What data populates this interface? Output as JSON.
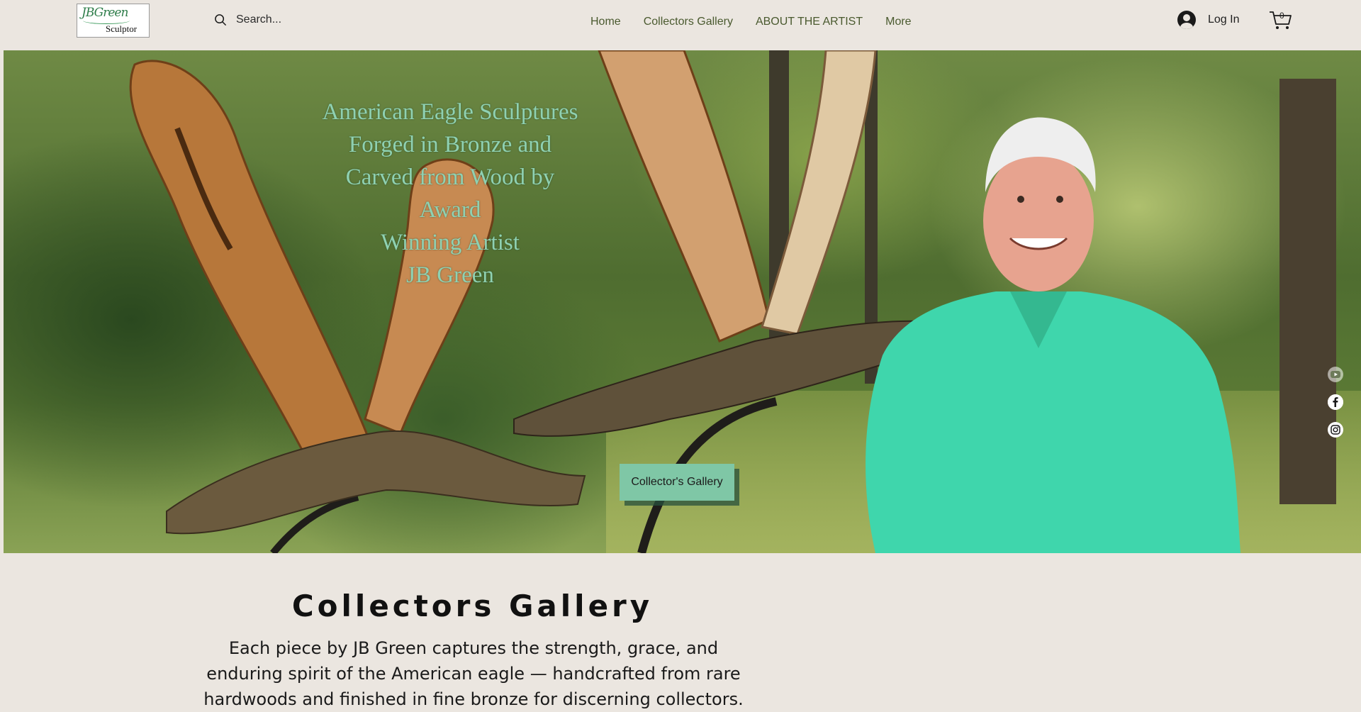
{
  "header": {
    "logo": {
      "script_text": "JBGreen",
      "sub_text": "Sculptor"
    },
    "search": {
      "placeholder": "Search..."
    },
    "nav": [
      {
        "label": "Home"
      },
      {
        "label": "Collectors Gallery"
      },
      {
        "label": "ABOUT THE ARTIST"
      },
      {
        "label": "More"
      }
    ],
    "login_label": "Log In",
    "cart_count": "0"
  },
  "hero": {
    "headline_lines": [
      "American Eagle Sculptures",
      "Forged in Bronze and",
      "Carved from Wood by",
      "Award",
      "Winning Artist",
      "JB Green"
    ],
    "cta_label": "Collector's Gallery",
    "social": [
      {
        "icon": "youtube-icon"
      },
      {
        "icon": "facebook-icon"
      },
      {
        "icon": "instagram-icon"
      }
    ]
  },
  "section": {
    "title": "Collectors Gallery",
    "description": "Each piece by JB Green captures the strength, grace, and enduring spirit of the American eagle — handcrafted from rare hardwoods and finished in fine bronze for discerning collectors."
  },
  "colors": {
    "background": "#ebe6e0",
    "nav_text": "#4a5a2f",
    "headline": "#8fd1b2",
    "cta": "#7fc7a6"
  }
}
